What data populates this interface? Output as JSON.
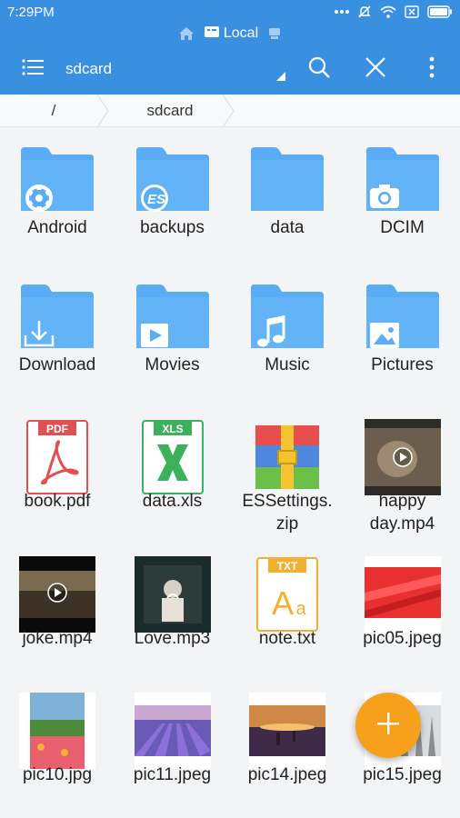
{
  "status_bar": {
    "time": "7:29PM",
    "icons": [
      "dots-icon",
      "mute-icon",
      "wifi-icon",
      "sim-icon",
      "battery-icon"
    ]
  },
  "location_bar": {
    "label": "Local"
  },
  "toolbar": {
    "title": "sdcard"
  },
  "breadcrumb": {
    "root": "/",
    "current": "sdcard"
  },
  "colors": {
    "accent": "#3a90e0",
    "folder": "#5aadf5",
    "fab": "#f7a01c"
  },
  "files": [
    {
      "name": "Android",
      "kind": "folder",
      "badge": "gear-icon"
    },
    {
      "name": "backups",
      "kind": "folder",
      "badge": "es-icon"
    },
    {
      "name": "data",
      "kind": "folder",
      "badge": ""
    },
    {
      "name": "DCIM",
      "kind": "folder",
      "badge": "camera-icon"
    },
    {
      "name": "Download",
      "kind": "folder",
      "badge": "download-icon"
    },
    {
      "name": "Movies",
      "kind": "folder",
      "badge": "play-icon"
    },
    {
      "name": "Music",
      "kind": "folder",
      "badge": "music-icon"
    },
    {
      "name": "Pictures",
      "kind": "folder",
      "badge": "image-icon"
    },
    {
      "name": "book.pdf",
      "kind": "pdf",
      "tag": "PDF"
    },
    {
      "name": "data.xls",
      "kind": "xls",
      "tag": "XLS"
    },
    {
      "name": "ESSettings.\nzip",
      "kind": "zip"
    },
    {
      "name": "happy\nday.mp4",
      "kind": "video"
    },
    {
      "name": "joke.mp4",
      "kind": "video"
    },
    {
      "name": "Love.mp3",
      "kind": "audio"
    },
    {
      "name": "note.txt",
      "kind": "txt",
      "tag": "TXT"
    },
    {
      "name": "pic05.jpeg",
      "kind": "image"
    },
    {
      "name": "pic10.jpg",
      "kind": "image"
    },
    {
      "name": "pic11.jpeg",
      "kind": "image"
    },
    {
      "name": "pic14.jpeg",
      "kind": "image"
    },
    {
      "name": "pic15.jpeg",
      "kind": "image"
    }
  ]
}
